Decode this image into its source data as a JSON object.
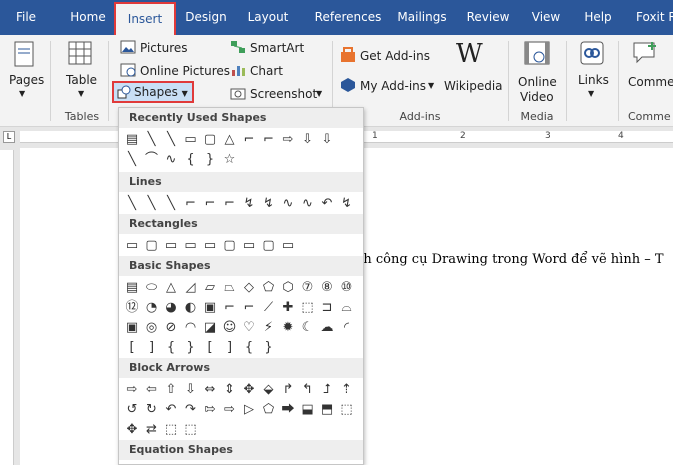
{
  "tabs": [
    "File",
    "Home",
    "Insert",
    "Design",
    "Layout",
    "References",
    "Mailings",
    "Review",
    "View",
    "Help",
    "Foxit Re"
  ],
  "ribbon": {
    "pages": "Pages",
    "table": "Table",
    "tables_group": "Tables",
    "pictures": "Pictures",
    "online_pictures": "Online Pictures",
    "shapes": "Shapes",
    "smartart": "SmartArt",
    "chart": "Chart",
    "screenshot": "Screenshot",
    "get_addins": "Get Add-ins",
    "my_addins": "My Add-ins",
    "wikipedia": "Wikipedia",
    "addins_group": "Add-ins",
    "online_video_1": "Online",
    "online_video_2": "Video",
    "media_group": "Media",
    "links": "Links",
    "comment": "Comme",
    "comments_group": "Comme"
  },
  "ruler": {
    "marks": [
      "1",
      "2",
      "3",
      "4"
    ]
  },
  "document": {
    "text": "nh công cụ Drawing trong Word để vẽ hình – T"
  },
  "menu": {
    "sections": [
      "Recently Used Shapes",
      "Lines",
      "Rectangles",
      "Basic Shapes",
      "Block Arrows",
      "Equation Shapes"
    ]
  },
  "shapes": {
    "recent_row1": [
      "▤",
      "╲",
      "╲",
      "▭",
      "▢",
      "△",
      "⌐",
      "⌐",
      "⇨",
      "⇩",
      "⇩"
    ],
    "recent_row2": [
      "╲",
      "⌒",
      "∿",
      "{",
      "}",
      "☆"
    ],
    "lines": [
      "╲",
      "╲",
      "╲",
      "⌐",
      "⌐",
      "⌐",
      "↯",
      "↯",
      "∿",
      "∿",
      "↶",
      "↯"
    ],
    "rectangles": [
      "▭",
      "▢",
      "▭",
      "▭",
      "▭",
      "▢",
      "▭",
      "▢",
      "▭"
    ],
    "basic_row1": [
      "▤",
      "⬭",
      "△",
      "◿",
      "▱",
      "⏢",
      "◇",
      "⬠",
      "⬡",
      "⑦",
      "⑧",
      "⑩"
    ],
    "basic_row2": [
      "⑫",
      "◔",
      "◕",
      "◐",
      "▣",
      "⌐",
      "⌐",
      "⟋",
      "✚",
      "⬚",
      "⊐",
      "⌓"
    ],
    "basic_row3": [
      "▣",
      "◎",
      "⊘",
      "◠",
      "◪",
      "☺",
      "♡",
      "⚡",
      "✹",
      "☾",
      "☁",
      "◜"
    ],
    "basic_row4": [
      "[",
      "]",
      "{",
      "}",
      "[",
      "]",
      "{",
      "}"
    ],
    "arrows_row1": [
      "⇨",
      "⇦",
      "⇧",
      "⇩",
      "⇔",
      "⇕",
      "✥",
      "⬙",
      "↱",
      "↰",
      "⮥",
      "⇡"
    ],
    "arrows_row2": [
      "↺",
      "↻",
      "↶",
      "↷",
      "⇰",
      "⇨",
      "▷",
      "⬠",
      "⮕",
      "⬓",
      "⬒",
      "⬚"
    ],
    "arrows_row3": [
      "✥",
      "⇄",
      "⬚",
      "⬚"
    ]
  }
}
